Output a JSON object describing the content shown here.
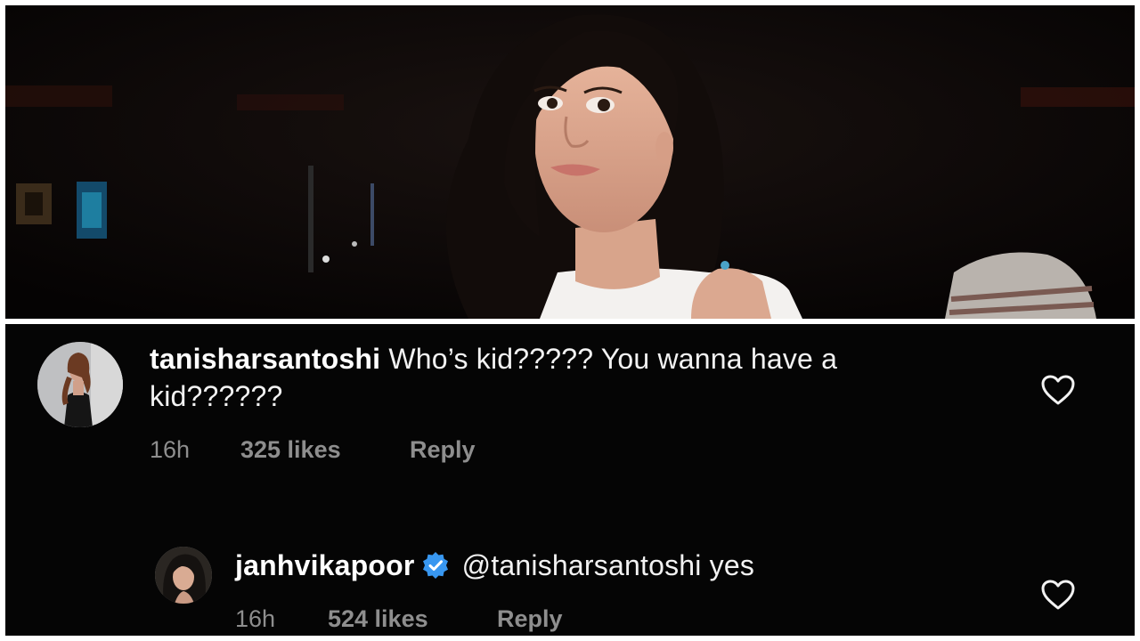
{
  "comments": [
    {
      "username": "tanisharsantoshi",
      "text": "Who’s kid????? You wanna have a kid??????",
      "time": "16h",
      "likes": "325 likes",
      "reply_label": "Reply",
      "verified": false
    },
    {
      "username": "janhvikapoor",
      "text": "@tanisharsantoshi yes",
      "time": "16h",
      "likes": "524 likes",
      "reply_label": "Reply",
      "verified": true
    }
  ],
  "icons": {
    "like": "heart-outline-icon",
    "verified": "verified-badge-icon"
  },
  "colors": {
    "background": "#050505",
    "text": "#f2f2f2",
    "meta": "#8e8e8e",
    "verified": "#3897f0"
  }
}
